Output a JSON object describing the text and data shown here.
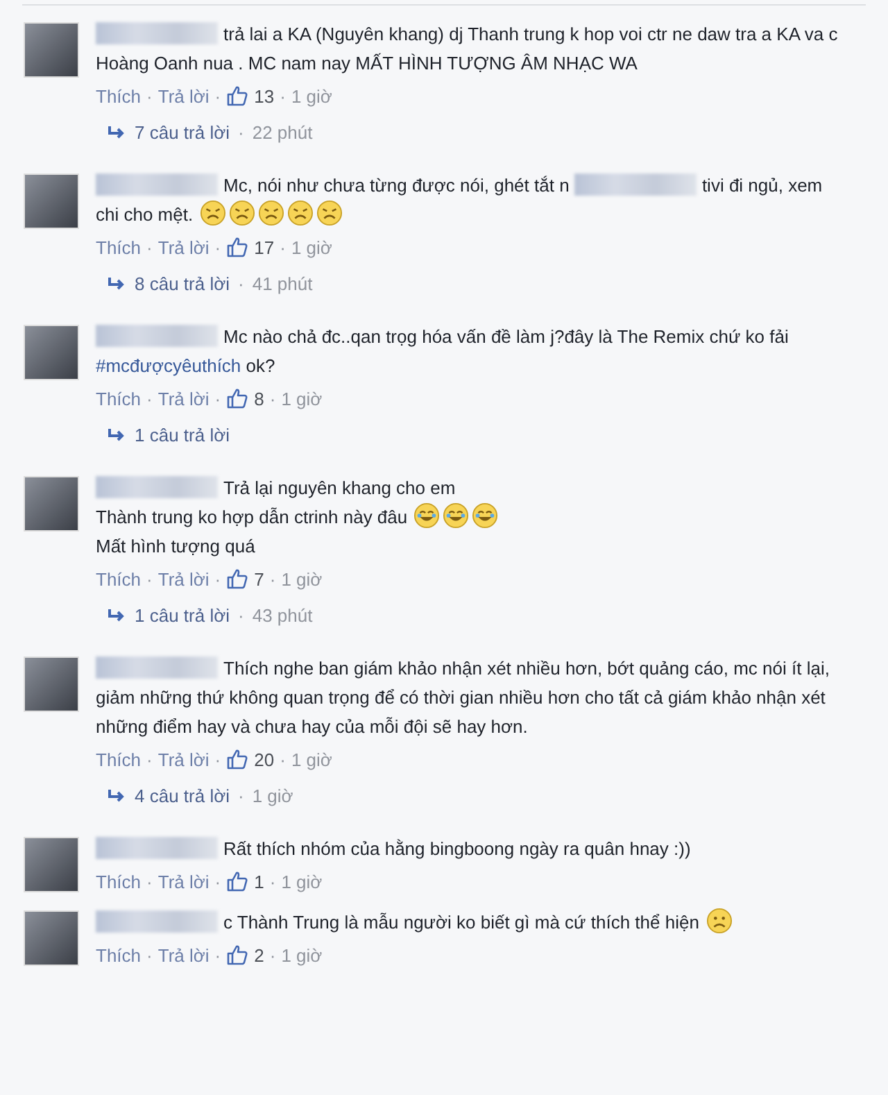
{
  "comments": [
    {
      "segments": [
        {
          "kind": "redacted"
        },
        {
          "kind": "text",
          "text": "trả lai a KA (Nguyên khang) dj Thanh trung k hop voi ctr ne daw tra a KA va c Hoàng Oanh nua . MC nam nay MẤT HÌNH TƯỢNG ÂM NHẠC WA"
        }
      ],
      "like_label": "Thích",
      "separators": [
        "·",
        "·",
        "·"
      ],
      "reply_label": "Trả lời",
      "likes": "13",
      "time": "1 giờ",
      "replies": {
        "count": "7 câu trả lời",
        "separator": "·",
        "time": "22 phút"
      }
    },
    {
      "segments": [
        {
          "kind": "redacted"
        },
        {
          "kind": "text",
          "text": "Mc, nói như chưa từng được nói, ghét tắt n"
        },
        {
          "kind": "redacted"
        },
        {
          "kind": "text",
          "text": "tivi đi ngủ, xem chi cho mệt."
        },
        {
          "kind": "weary_face"
        },
        {
          "kind": "weary_face"
        },
        {
          "kind": "weary_face"
        },
        {
          "kind": "weary_face"
        },
        {
          "kind": "weary_face"
        }
      ],
      "like_label": "Thích",
      "separators": [
        "·",
        "·",
        "·"
      ],
      "reply_label": "Trả lời",
      "likes": "17",
      "time": "1 giờ",
      "replies": {
        "count": "8 câu trả lời",
        "separator": "·",
        "time": "41 phút"
      }
    },
    {
      "segments": [
        {
          "kind": "redacted"
        },
        {
          "kind": "text",
          "text": "Mc nào chả đc..qan trọg hóa vấn đề làm j?đây là The Remix chứ ko fải"
        },
        {
          "kind": "hashtag",
          "text": "#mcđượcyêuthích"
        },
        {
          "kind": "text",
          "text": "ok?"
        }
      ],
      "like_label": "Thích",
      "separators": [
        "·",
        "·",
        "·"
      ],
      "reply_label": "Trả lời",
      "likes": "8",
      "time": "1 giờ",
      "replies": {
        "count": "1 câu trả lời"
      }
    },
    {
      "segments": [
        {
          "kind": "redacted"
        },
        {
          "kind": "text",
          "text": "Trả lại nguyên khang cho em"
        },
        {
          "kind": "break"
        },
        {
          "kind": "text",
          "text": "Thành trung ko hợp dẫn ctrinh này đâu"
        },
        {
          "kind": "laughing_face"
        },
        {
          "kind": "laughing_face"
        },
        {
          "kind": "laughing_face"
        },
        {
          "kind": "break"
        },
        {
          "kind": "text",
          "text": "Mất hình tượng quá"
        }
      ],
      "like_label": "Thích",
      "separators": [
        "·",
        "·",
        "·"
      ],
      "reply_label": "Trả lời",
      "likes": "7",
      "time": "1 giờ",
      "replies": {
        "count": "1 câu trả lời",
        "separator": "·",
        "time": "43 phút"
      }
    },
    {
      "segments": [
        {
          "kind": "redacted"
        },
        {
          "kind": "text",
          "text": "Thích nghe ban giám khảo nhận xét nhiều hơn, bớt quảng cáo, mc nói ít lại, giảm những thứ không quan trọng để có thời gian nhiều hơn cho tất cả giám khảo nhận xét những điểm hay và chưa hay của mỗi đội sẽ hay hơn."
        }
      ],
      "like_label": "Thích",
      "separators": [
        "·",
        "·",
        "·"
      ],
      "reply_label": "Trả lời",
      "likes": "20",
      "time": "1 giờ",
      "replies": {
        "count": "4 câu trả lời",
        "separator": "·",
        "time": "1 giờ"
      }
    },
    {
      "segments": [
        {
          "kind": "redacted"
        },
        {
          "kind": "text",
          "text": "Rất thích nhóm của hằng bingboong ngày ra quân hnay :))"
        }
      ],
      "like_label": "Thích",
      "separators": [
        "·",
        "·",
        "·"
      ],
      "reply_label": "Trả lời",
      "likes": "1",
      "time": "1 giờ"
    },
    {
      "segments": [
        {
          "kind": "redacted"
        },
        {
          "kind": "text",
          "text": "c Thành Trung là mẫu người ko biết gì mà cứ thích thể hiện"
        },
        {
          "kind": "frowning_face"
        }
      ],
      "like_label": "Thích",
      "separators": [
        "·",
        "·",
        "·"
      ],
      "reply_label": "Trả lời",
      "likes": "2",
      "time": "1 giờ"
    }
  ]
}
